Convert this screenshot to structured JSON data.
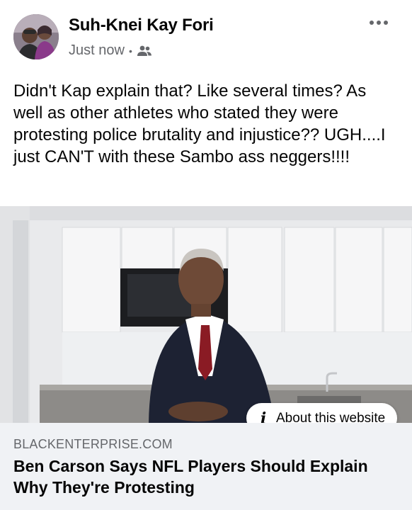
{
  "post": {
    "author_name": "Suh-Knei Kay Fori",
    "timestamp": "Just now",
    "separator": "•",
    "audience_icon": "friends-icon",
    "more_icon": "more-horizontal-icon",
    "text": "Didn't Kap explain that? Like several times? As well as other athletes who stated they were protesting police brutality and injustice?? UGH....I just CAN'T with these Sambo ass neggers!!!!"
  },
  "link_preview": {
    "about_icon": "info-icon",
    "about_glyph": "i",
    "about_label": "About this website",
    "domain": "BLACKENTERPRISE.COM",
    "title": "Ben Carson Says NFL Players Should Explain Why They're Protesting"
  },
  "colors": {
    "secondary_text": "#65676b",
    "card_background": "#f0f2f5",
    "primary_text": "#050505"
  }
}
